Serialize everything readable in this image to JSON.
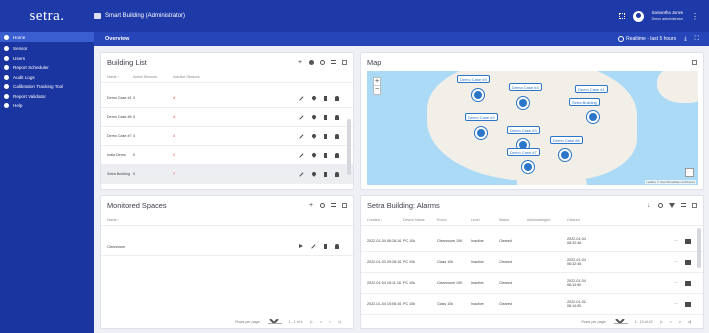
{
  "app": {
    "logo": "setra.",
    "title": "Smart Building (Administrator)",
    "user_name": "Samantha Jones",
    "user_role": "Demo administrator"
  },
  "subbar": {
    "title": "Overview",
    "realtime": "Realtime - last 5 hours"
  },
  "sidebar": {
    "items": [
      {
        "label": "Home",
        "icon": "home-icon",
        "active": true
      },
      {
        "label": "Sensor",
        "icon": "sensor-icon"
      },
      {
        "label": "Users",
        "icon": "users-icon"
      },
      {
        "label": "Report Scheduler",
        "icon": "schedule-icon"
      },
      {
        "label": "Audit Logs",
        "icon": "audit-icon"
      },
      {
        "label": "Calibration Tracking Tool",
        "icon": "calibration-icon"
      },
      {
        "label": "Report Validator",
        "icon": "validator-icon"
      },
      {
        "label": "Help",
        "icon": "help-icon"
      }
    ]
  },
  "building_list": {
    "title": "Building List",
    "columns": [
      "Name ↑",
      "Active Sensors",
      "Inactive Sensors"
    ],
    "rows": [
      {
        "name": "Demo Case #1",
        "active": "0",
        "inactive": "4"
      },
      {
        "name": "Demo Case #6",
        "active": "0",
        "inactive": "4"
      },
      {
        "name": "Demo Case #7",
        "active": "0",
        "inactive": "4"
      },
      {
        "name": "India Demo",
        "active": "0",
        "inactive": "2"
      },
      {
        "name": "Setra Building",
        "active": "5",
        "inactive": "7",
        "selected": true
      }
    ]
  },
  "map": {
    "title": "Map",
    "attribution": "Leaflet | © OpenStreetMap contributors",
    "labels": [
      "Demo Case #5",
      "Demo Case #4",
      "Demo Case #1",
      "Setra Building",
      "Demo Case #2",
      "Demo Case #3",
      "Demo Case #6",
      "Demo Case #7"
    ]
  },
  "monitored_spaces": {
    "title": "Monitored Spaces",
    "column": "Name ↑",
    "rows": [
      {
        "name": "Cleanroom"
      }
    ],
    "pager": {
      "rows_label": "Rows per page:",
      "rows_value": "10",
      "range": "1 - 1 of 1"
    }
  },
  "alarms": {
    "title": "Setra Building: Alarms",
    "columns": [
      "Created ↓",
      "Device Name",
      "Room",
      "Level",
      "Status",
      "Acknowledged",
      "Cleared"
    ],
    "rows": [
      {
        "created": "2022-01-04 08:28:16",
        "device": "PC 10k",
        "room": "Cleanroom 10K",
        "level": "Inactive",
        "status": "Cleared",
        "ack": "",
        "cleared": "2022-01-04 08:32:46"
      },
      {
        "created": "2022-01-03 09:28:16",
        "device": "PC 10k",
        "room": "Class 10k",
        "level": "Inactive",
        "status": "Cleared",
        "ack": "",
        "cleared": "2022-01-04 08:32:46"
      },
      {
        "created": "2022-01-04 16:11:16",
        "device": "PC 10k",
        "room": "Cleanroom 10K",
        "level": "Inactive",
        "status": "Cleared",
        "ack": "",
        "cleared": "2022-01-04 08:14:50"
      },
      {
        "created": "2022-01-04 15:08:16",
        "device": "PC 10k",
        "room": "Class 10k",
        "level": "Inactive",
        "status": "Cleared",
        "ack": "",
        "cleared": "2022-01-02 08:14:50"
      }
    ],
    "pager": {
      "rows_label": "Rows per page:",
      "rows_value": "10",
      "range": "1 - 10 of 42"
    }
  }
}
